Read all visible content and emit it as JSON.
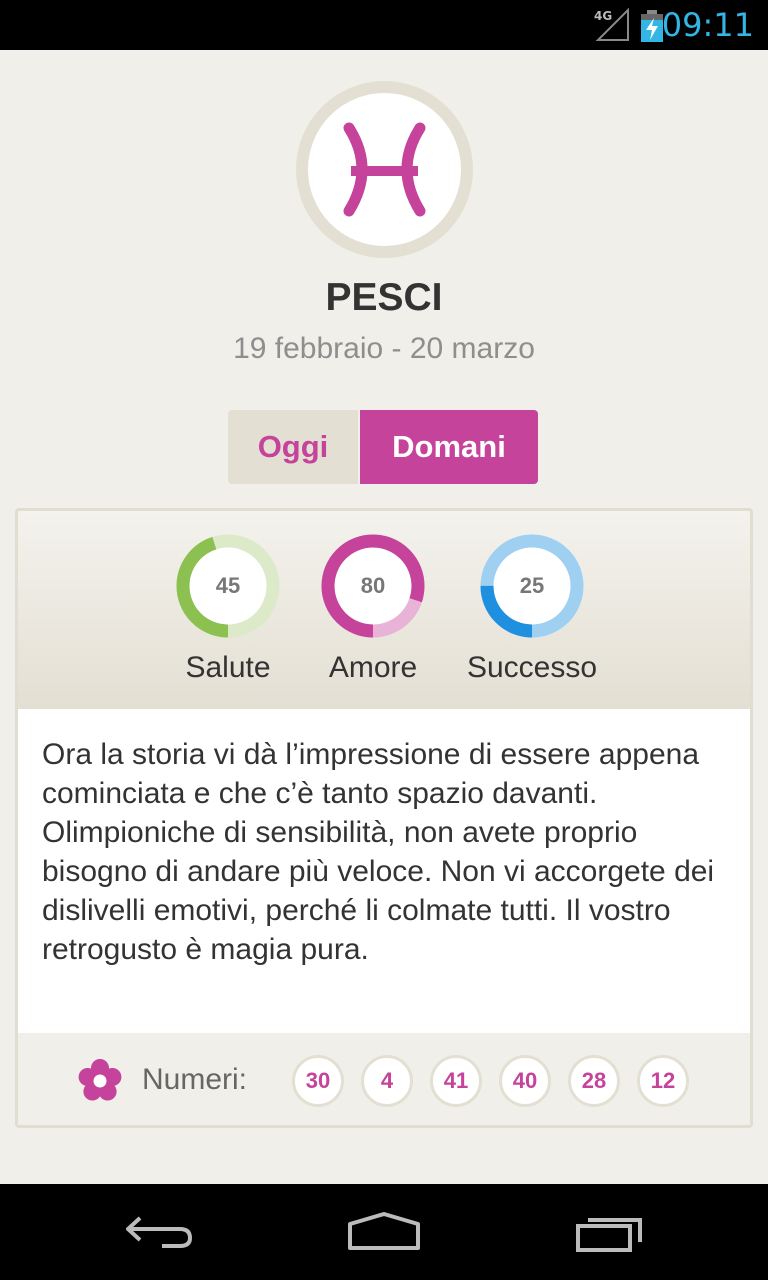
{
  "status_bar": {
    "network": "4G",
    "time": "09:11",
    "accent_color": "#33b5e5",
    "icons": [
      "signal-icon",
      "battery-charging-icon"
    ]
  },
  "sign": {
    "name": "PESCI",
    "dates": "19 febbraio - 20 marzo",
    "icon": "pisces-glyph-icon",
    "color": "#c5439a"
  },
  "tabs": [
    {
      "label": "Oggi",
      "selected": false
    },
    {
      "label": "Domani",
      "selected": true
    }
  ],
  "stats": [
    {
      "label": "Salute",
      "value": "45",
      "fraction": 0.45,
      "color": "#8cc152",
      "track": "#dceac9"
    },
    {
      "label": "Amore",
      "value": "80",
      "fraction": 0.8,
      "color": "#c5439a",
      "track": "#e8b3d6"
    },
    {
      "label": "Successo",
      "value": "25",
      "fraction": 0.25,
      "color": "#1f8fe0",
      "track": "#9fd0f2"
    }
  ],
  "horoscope_text": "Ora la storia vi dà l’impressione di essere appena cominciata e che c’è tanto spazio davanti. Olimpioniche di sensibilità, non avete proprio bisogno di andare più veloce. Non vi accorgete dei dislivelli emotivi, perché li colmate tutti. Il vostro retrogusto è magia pura.",
  "lucky_numbers": {
    "label": "Numeri:",
    "icon": "flower-icon",
    "values": [
      "30",
      "4",
      "41",
      "40",
      "28",
      "12"
    ]
  },
  "nav_bar": {
    "icons": [
      "back-icon",
      "home-icon",
      "recent-apps-icon"
    ]
  }
}
